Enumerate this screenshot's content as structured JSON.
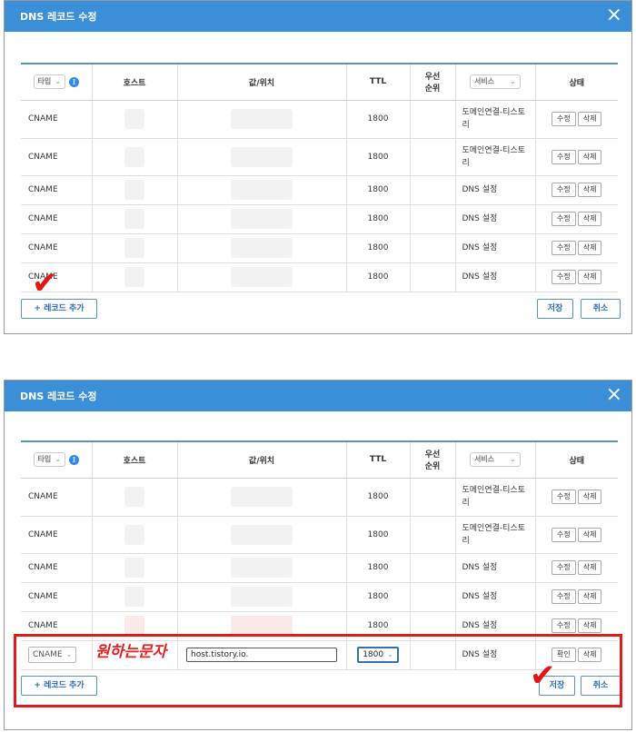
{
  "dialog_title": "DNS 레코드 수정",
  "close_glyph": "×",
  "header": {
    "type_select": "타입",
    "info_glyph": "i",
    "host": "호스트",
    "value": "값/위치",
    "ttl": "TTL",
    "priority_line1": "우선",
    "priority_line2": "순위",
    "service_select": "서비스",
    "status": "상태"
  },
  "chevron": "⌄",
  "rows": [
    {
      "type": "CNAME",
      "ttl": "1800",
      "service": "도메인연결-티스토리"
    },
    {
      "type": "CNAME",
      "ttl": "1800",
      "service": "도메인연결-티스토리"
    },
    {
      "type": "CNAME",
      "ttl": "1800",
      "service": "DNS 설정"
    },
    {
      "type": "CNAME",
      "ttl": "1800",
      "service": "DNS 설정"
    },
    {
      "type": "CNAME",
      "ttl": "1800",
      "service": "DNS 설정"
    },
    {
      "type": "CNAME",
      "ttl": "1800",
      "service": "DNS 설정"
    }
  ],
  "rows2": [
    {
      "type": "CNAME",
      "ttl": "1800",
      "service": "도메인연결-티스토리"
    },
    {
      "type": "CNAME",
      "ttl": "1800",
      "service": "도메인연결-티스토리"
    },
    {
      "type": "CNAME",
      "ttl": "1800",
      "service": "DNS 설정"
    },
    {
      "type": "CNAME",
      "ttl": "1800",
      "service": "DNS 설정"
    },
    {
      "type": "CNAME",
      "ttl": "1800",
      "service": "DNS 설정"
    }
  ],
  "buttons": {
    "edit": "수정",
    "delete": "삭제",
    "confirm": "확인",
    "add_record": "+ 레코드 추가",
    "save": "저장",
    "cancel": "취소"
  },
  "new_row": {
    "type": "CNAME",
    "value": "host.tistory.io.",
    "ttl": "1800",
    "service": "DNS 설정"
  },
  "annotation": {
    "text": "원하는문자",
    "check_glyph": "✔",
    "color": "#e11b1b"
  },
  "colors": {
    "titlebar": "#3b8fd9",
    "accent": "#2a6cb5"
  }
}
